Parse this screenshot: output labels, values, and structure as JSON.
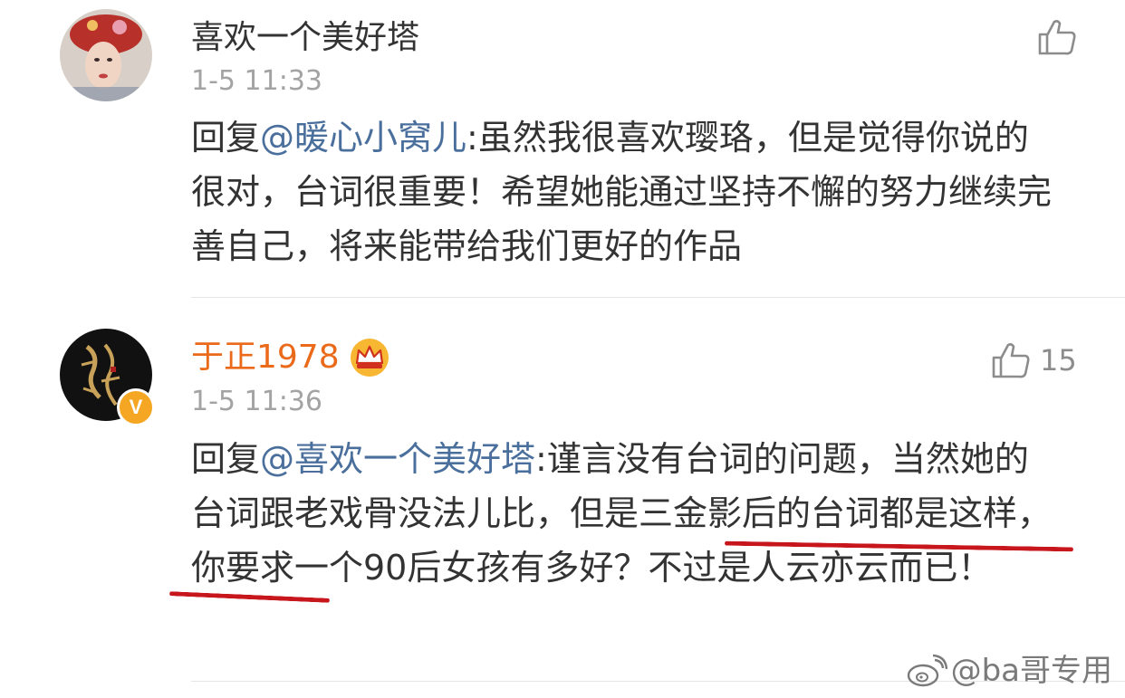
{
  "colors": {
    "mention_link": "#4a6f9c",
    "vip_username": "#ea6a1a",
    "timestamp": "#a3a3a3",
    "annotation_underline": "#c8161d"
  },
  "comments": [
    {
      "username": "喜欢一个美好塔",
      "timestamp": "1-5 11:33",
      "like_icon": "thumbs-up-icon",
      "like_count": "",
      "reply_prefix": "回复",
      "mention": "@暖心小窝儿",
      "text": ":虽然我很喜欢璎珞，但是觉得你说的很对，台词很重要！希望她能通过坚持不懈的努力继续完善自己，将来能带给我们更好的作品"
    },
    {
      "username": "于正1978",
      "badge_icon": "crown-icon",
      "verified_icon": "verified-v-icon",
      "verified_label": "V",
      "timestamp": "1-5 11:36",
      "like_icon": "thumbs-up-icon",
      "like_count": "15",
      "reply_prefix": "回复",
      "mention": "@喜欢一个美好塔",
      "text": ":谨言没有台词的问题，当然她的台词跟老戏骨没法儿比，但是三金影后的台词都是这样，你要求一个90后女孩有多好？不过是人云亦云而已！"
    }
  ],
  "watermark": {
    "icon": "weibo-icon",
    "text": "@ba哥专用"
  }
}
